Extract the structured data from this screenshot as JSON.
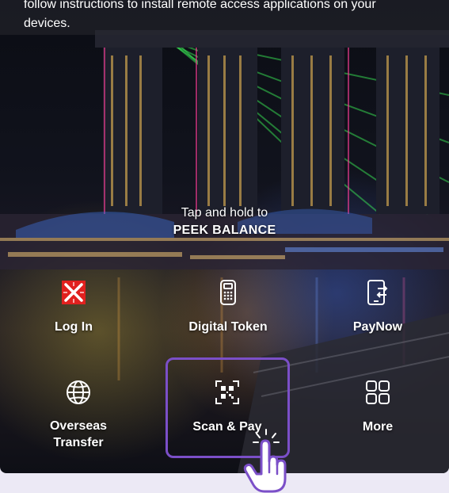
{
  "notice": {
    "text": "follow instructions to install remote access applications on your devices."
  },
  "peek": {
    "line1": "Tap and hold to",
    "line2": "PEEK BALANCE"
  },
  "tiles": {
    "login": {
      "label": "Log In",
      "icon": "dbs-logo-icon"
    },
    "digital_token": {
      "label": "Digital Token",
      "icon": "token-device-icon"
    },
    "paynow": {
      "label": "PayNow",
      "icon": "phone-transfer-icon"
    },
    "overseas": {
      "label": "Overseas\nTransfer",
      "icon": "globe-icon"
    },
    "scan_pay": {
      "label": "Scan & Pay",
      "icon": "qr-scan-icon"
    },
    "more": {
      "label": "More",
      "icon": "grid-icon"
    }
  },
  "colors": {
    "brand_red": "#e1211f",
    "highlight": "#7b4fc8",
    "page_bg": "#ece9f5"
  }
}
